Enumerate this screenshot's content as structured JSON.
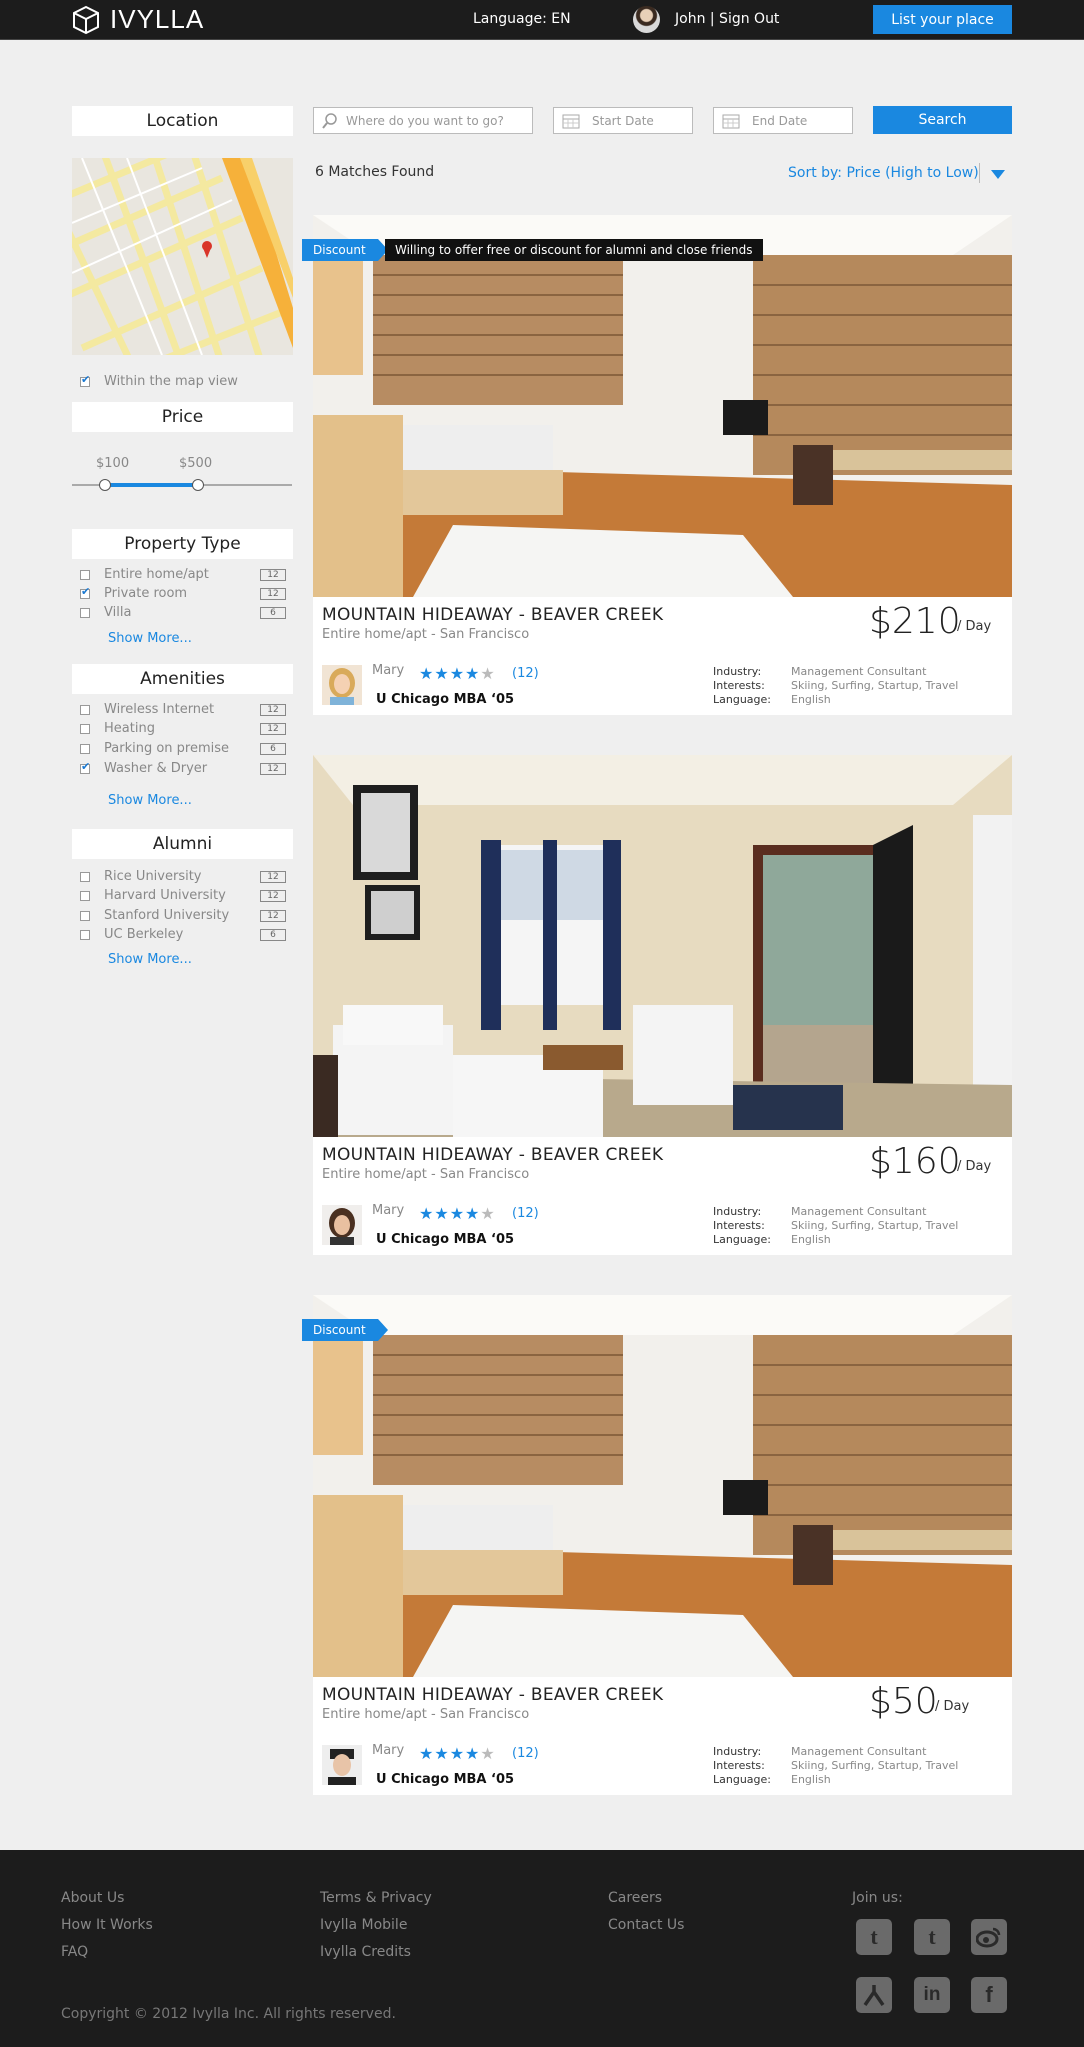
{
  "header": {
    "brand": "IVYLLA",
    "language": "Language: EN",
    "user": "John | Sign Out",
    "list_button": "List your place"
  },
  "sidebar": {
    "location_title": "Location",
    "map_checkbox": "Within the map view",
    "price_title": "Price",
    "price_min": "$100",
    "price_max": "$500",
    "property_title": "Property Type",
    "property_items": [
      {
        "label": "Entire home/apt",
        "count": "12",
        "checked": false
      },
      {
        "label": "Private room",
        "count": "12",
        "checked": true
      },
      {
        "label": "Villa",
        "count": "6",
        "checked": false
      }
    ],
    "amenities_title": "Amenities",
    "amenity_items": [
      {
        "label": "Wireless Internet",
        "count": "12",
        "checked": false
      },
      {
        "label": "Heating",
        "count": "12",
        "checked": false
      },
      {
        "label": "Parking on premise",
        "count": "6",
        "checked": false
      },
      {
        "label": "Washer & Dryer",
        "count": "12",
        "checked": true
      }
    ],
    "alumni_title": "Alumni",
    "alumni_items": [
      {
        "label": "Rice University",
        "count": "12",
        "checked": false
      },
      {
        "label": "Harvard University",
        "count": "12",
        "checked": false
      },
      {
        "label": "Stanford University",
        "count": "12",
        "checked": false
      },
      {
        "label": "UC Berkeley",
        "count": "6",
        "checked": false
      }
    ],
    "show_more": "Show More..."
  },
  "search": {
    "where_placeholder": "Where do you want to go?",
    "start_placeholder": "Start Date",
    "end_placeholder": "End Date",
    "button": "Search",
    "matches": "6 Matches Found",
    "sort": "Sort by: Price (High to Low)"
  },
  "listings": [
    {
      "discount": "Discount",
      "tooltip": "Willing to offer free or discount for alumni and close friends",
      "title": "MOUNTAIN HIDEAWAY - BEAVER CREEK",
      "subtitle": "Entire home/apt - San Francisco",
      "price": "$210",
      "per": "/ Day",
      "host": "Mary",
      "rating": 4,
      "reviews": "(12)",
      "school": "U Chicago MBA ‘05",
      "industry_label": "Industry:",
      "industry": "Management Consultant",
      "interests_label": "Interests:",
      "interests": "Skiing, Surfing, Startup, Travel",
      "language_label": "Language:",
      "language": "English"
    },
    {
      "discount": "",
      "tooltip": "",
      "title": "MOUNTAIN HIDEAWAY - BEAVER CREEK",
      "subtitle": "Entire home/apt - San Francisco",
      "price": "$160",
      "per": "/ Day",
      "host": "Mary",
      "rating": 4,
      "reviews": "(12)",
      "school": "U Chicago MBA ‘05",
      "industry_label": "Industry:",
      "industry": "Management Consultant",
      "interests_label": "Interests:",
      "interests": "Skiing, Surfing, Startup, Travel",
      "language_label": "Language:",
      "language": "English"
    },
    {
      "discount": "Discount",
      "tooltip": "",
      "title": "MOUNTAIN HIDEAWAY - BEAVER CREEK",
      "subtitle": "Entire home/apt - San Francisco",
      "price": "$50",
      "per": "/ Day",
      "host": "Mary",
      "rating": 4,
      "reviews": "(12)",
      "school": "U Chicago MBA ‘05",
      "industry_label": "Industry:",
      "industry": "Management Consultant",
      "interests_label": "Interests:",
      "interests": "Skiing, Surfing, Startup, Travel",
      "language_label": "Language:",
      "language": "English"
    }
  ],
  "footer": {
    "col1": [
      "About Us",
      "How It Works",
      "FAQ"
    ],
    "col2": [
      "Terms & Privacy",
      "Ivylla Mobile",
      "Ivylla Credits"
    ],
    "col3": [
      "Careers",
      "Contact Us"
    ],
    "join": "Join us:",
    "social": [
      "tumblr-icon",
      "twitter-icon",
      "weibo-icon",
      "renren-icon",
      "linkedin-icon",
      "facebook-icon"
    ],
    "copyright": "Copyright © 2012 Ivylla Inc. All rights reserved."
  },
  "colors": {
    "accent": "#1a88e0",
    "header": "#1c1c1c",
    "page": "#efefef"
  }
}
